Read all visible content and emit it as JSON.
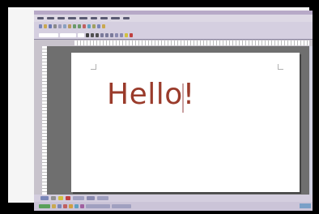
{
  "document": {
    "text": "Hello!"
  },
  "colors": {
    "text": "#9a3b2b",
    "page": "#ffffff",
    "workspace": "#6f6f6f",
    "chrome": "#d5cfe0",
    "title_bar": "#b7a9c7"
  },
  "icons": {
    "toolbar_row_1": [
      "new-icon",
      "open-icon",
      "save-icon",
      "print-icon",
      "cut-icon",
      "copy-icon",
      "paste-icon",
      "undo-icon",
      "redo-icon"
    ],
    "toolbar_row_2": [
      "bold-icon",
      "italic-icon",
      "underline-icon",
      "align-left-icon",
      "align-center-icon",
      "align-right-icon",
      "bullets-icon",
      "numbering-icon"
    ],
    "status_bar": [
      "draw-icon",
      "shapes-icon",
      "fill-color-icon",
      "font-color-icon"
    ]
  }
}
